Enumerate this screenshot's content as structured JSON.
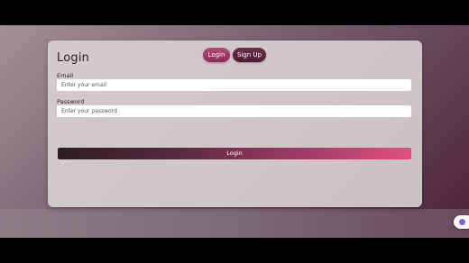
{
  "card": {
    "title": "Login",
    "toggle_login": "Login",
    "toggle_signup": "Sign Up"
  },
  "form": {
    "email_label": "Email",
    "email_placeholder": "Enter your email",
    "email_value": "",
    "password_label": "Password",
    "password_placeholder": "Enter your password",
    "password_value": "",
    "submit_label": "Login"
  },
  "floating_widget": {
    "icon": "chat-bubble-icon",
    "accent": "#8b5bd6"
  },
  "colors": {
    "toggle_active": "#a2416a",
    "toggle_inactive": "#5e2540",
    "button_gradient_start": "#2c1e24",
    "button_gradient_end": "#e0507f"
  }
}
